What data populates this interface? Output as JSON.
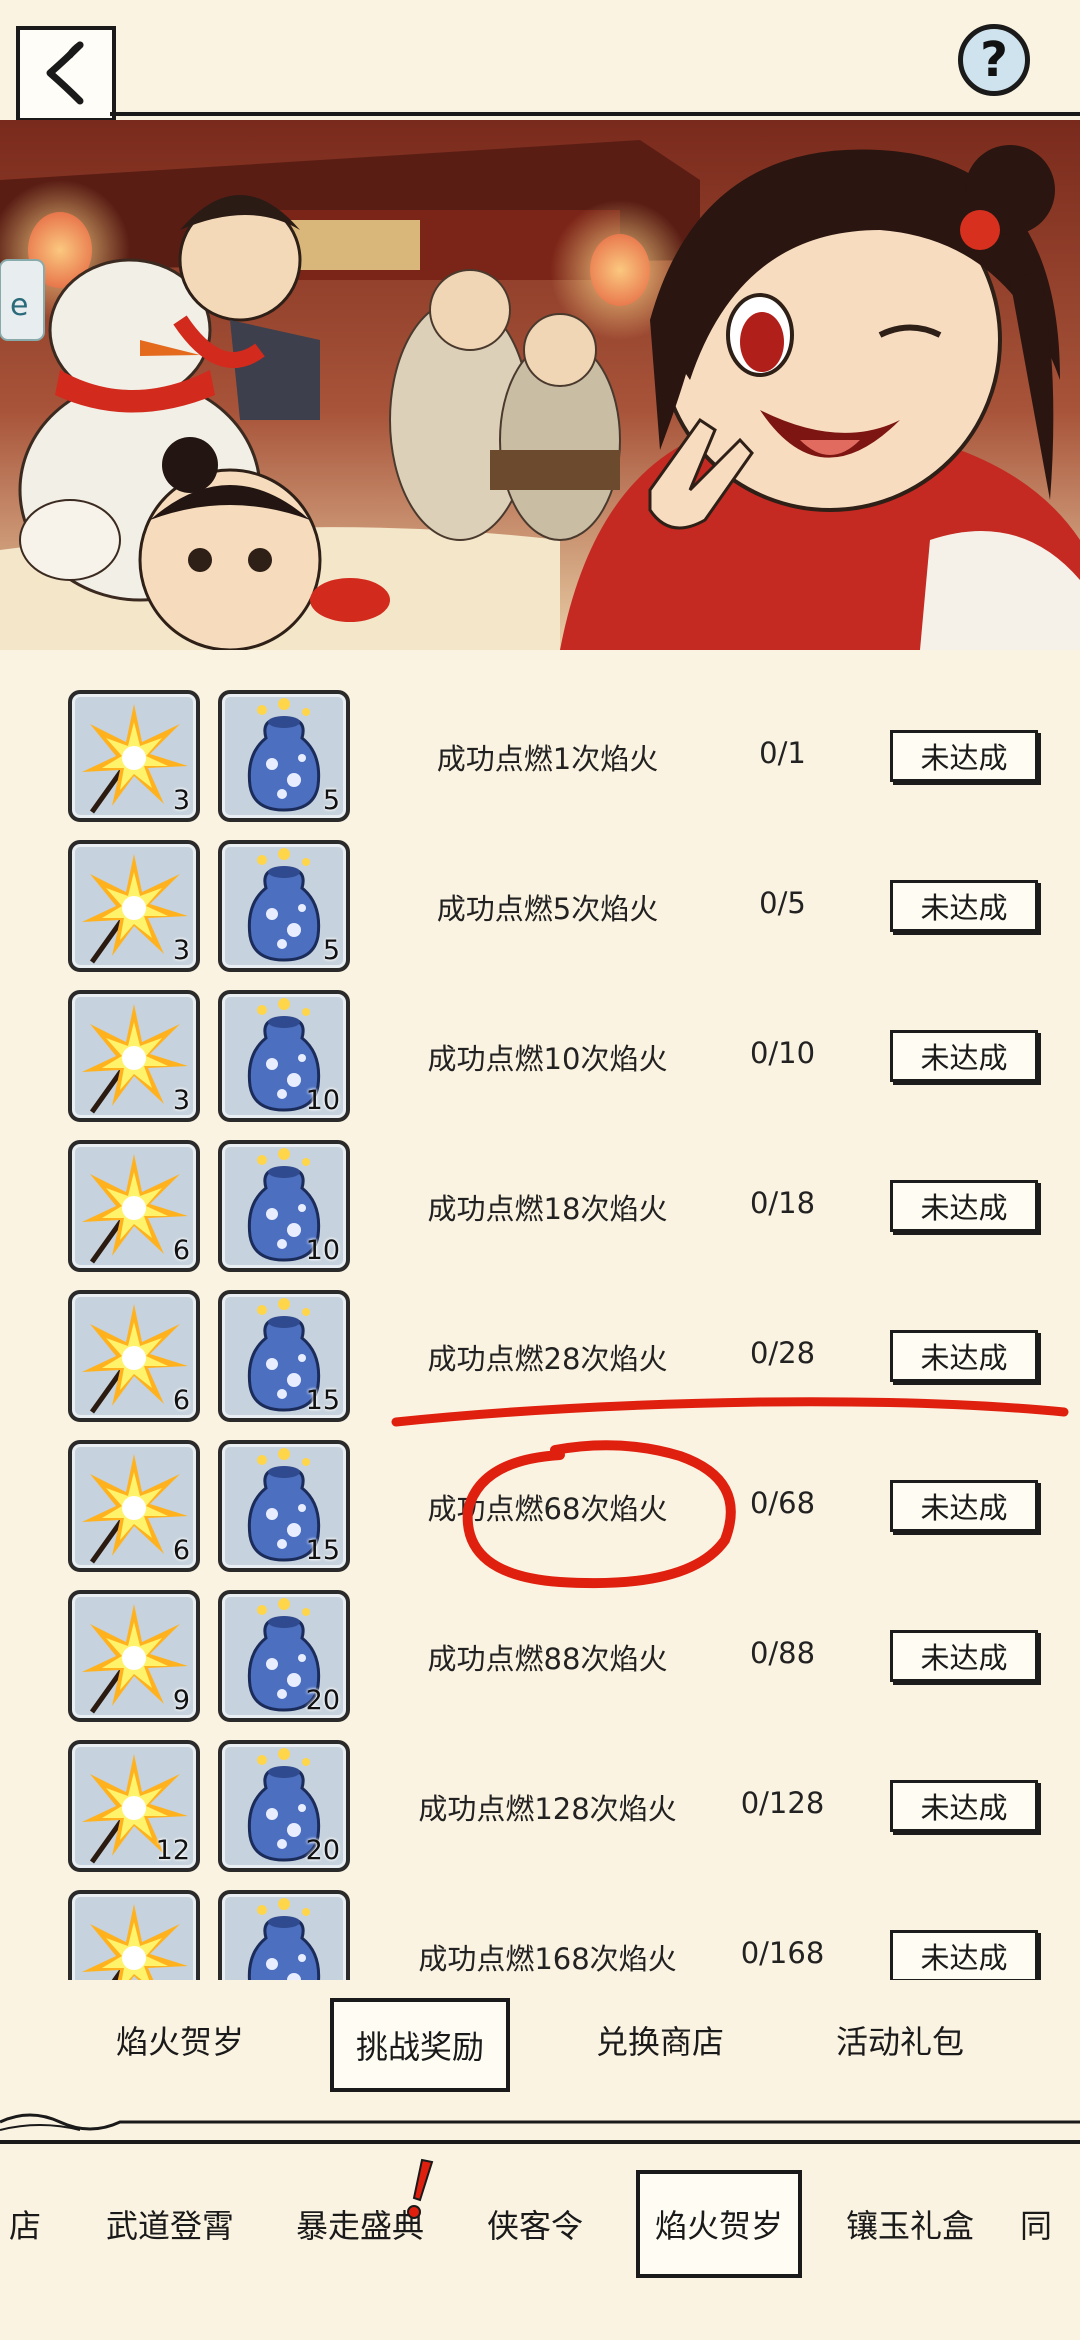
{
  "header": {
    "back_icon": "chevron-left-icon",
    "help_label": "?"
  },
  "rewards": [
    {
      "task": "成功点燃1次焰火",
      "progress": "0/1",
      "status": "未达成",
      "firework_qty": "3",
      "jar_qty": "5"
    },
    {
      "task": "成功点燃5次焰火",
      "progress": "0/5",
      "status": "未达成",
      "firework_qty": "3",
      "jar_qty": "5"
    },
    {
      "task": "成功点燃10次焰火",
      "progress": "0/10",
      "status": "未达成",
      "firework_qty": "3",
      "jar_qty": "10"
    },
    {
      "task": "成功点燃18次焰火",
      "progress": "0/18",
      "status": "未达成",
      "firework_qty": "6",
      "jar_qty": "10"
    },
    {
      "task": "成功点燃28次焰火",
      "progress": "0/28",
      "status": "未达成",
      "firework_qty": "6",
      "jar_qty": "15"
    },
    {
      "task": "成功点燃68次焰火",
      "progress": "0/68",
      "status": "未达成",
      "firework_qty": "6",
      "jar_qty": "15"
    },
    {
      "task": "成功点燃88次焰火",
      "progress": "0/88",
      "status": "未达成",
      "firework_qty": "9",
      "jar_qty": "20"
    },
    {
      "task": "成功点燃128次焰火",
      "progress": "0/128",
      "status": "未达成",
      "firework_qty": "12",
      "jar_qty": "20"
    },
    {
      "task": "成功点燃168次焰火",
      "progress": "0/168",
      "status": "未达成",
      "firework_qty": "",
      "jar_qty": ""
    }
  ],
  "sub_tabs": [
    {
      "label": "焰火贺岁",
      "active": false
    },
    {
      "label": "挑战奖励",
      "active": true
    },
    {
      "label": "兑换商店",
      "active": false
    },
    {
      "label": "活动礼包",
      "active": false
    }
  ],
  "bottom_tabs": [
    {
      "label": "店",
      "active": false
    },
    {
      "label": "武道登霄",
      "active": false
    },
    {
      "label": "暴走盛典",
      "active": false
    },
    {
      "label": "侠客令",
      "active": false
    },
    {
      "label": "焰火贺岁",
      "active": true
    },
    {
      "label": "镶玉礼盒",
      "active": false
    },
    {
      "label": "同",
      "active": false
    }
  ],
  "colors": {
    "background": "#fbf3e2",
    "annotation_red": "#e0200f",
    "icon_tile": "#c6d2dd"
  }
}
